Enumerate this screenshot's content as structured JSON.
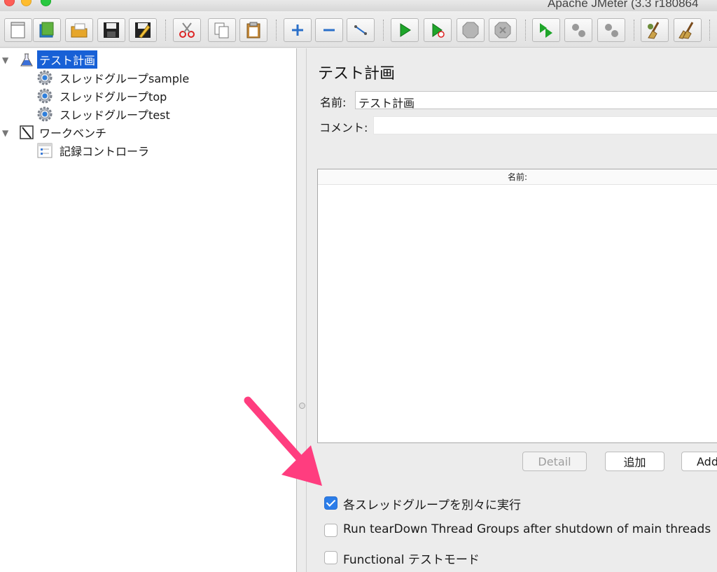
{
  "window": {
    "title": "Apache JMeter (3.3 r180864"
  },
  "toolbar": {
    "buttons": [
      "new-icon",
      "templates-icon",
      "open-icon",
      "save-icon",
      "save-as-icon",
      "cut-icon",
      "copy-icon",
      "paste-icon",
      "expand-icon",
      "collapse-icon",
      "toggle-icon",
      "start-icon",
      "start-no-pause-icon",
      "stop-icon",
      "shutdown-icon",
      "remote-start-icon",
      "remote-stop-icon",
      "remote-shutdown-icon",
      "clear-icon",
      "clear-all-icon"
    ]
  },
  "tree": {
    "items": [
      {
        "label": "テスト計画",
        "icon": "flask-icon",
        "selected": true
      },
      {
        "label": "スレッドグループsample",
        "icon": "gear-icon"
      },
      {
        "label": "スレッドグループtop",
        "icon": "gear-icon"
      },
      {
        "label": "スレッドグループtest",
        "icon": "gear-icon"
      },
      {
        "label": "ワークベンチ",
        "icon": "workbench-icon"
      },
      {
        "label": "記録コントローラ",
        "icon": "recorder-icon"
      }
    ]
  },
  "panel": {
    "title": "テスト計画",
    "name_label": "名前:",
    "name_value": "テスト計画",
    "comment_label": "コメント:",
    "comment_value": "",
    "table_header": "名前:",
    "buttons": {
      "detail": "Detail",
      "add": "追加",
      "add_from_clipboard": "Add"
    },
    "checkboxes": [
      {
        "label": "各スレッドグループを別々に実行",
        "checked": true
      },
      {
        "label": "Run tearDown Thread Groups after shutdown of main threads",
        "checked": false
      },
      {
        "label": "Functional テストモード",
        "checked": false
      }
    ]
  },
  "colors": {
    "selection": "#1760d6",
    "checkbox_on": "#2b7de9",
    "annotation_arrow": "#ff3d7f"
  }
}
